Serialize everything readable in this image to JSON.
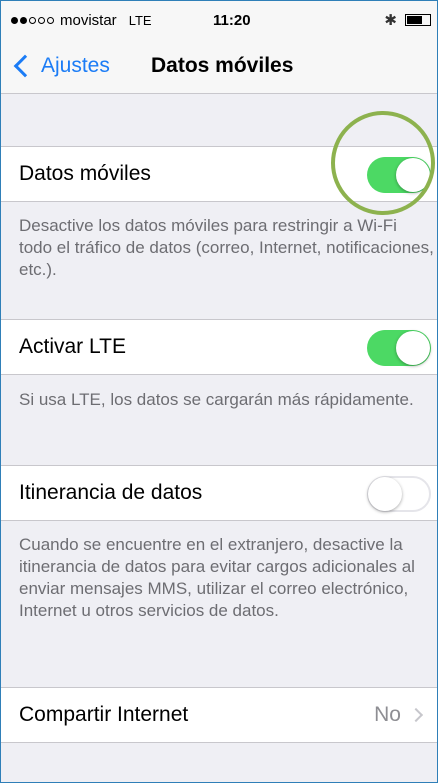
{
  "status_bar": {
    "signal_dots": [
      true,
      true,
      false,
      false,
      false
    ],
    "carrier": "movistar",
    "network": "LTE",
    "time": "11:20",
    "bluetooth_icon": "bluetooth-icon",
    "battery_level": 0.7
  },
  "nav": {
    "back_label": "Ajustes",
    "title": "Datos móviles"
  },
  "settings": {
    "datos_moviles": {
      "label": "Datos móviles",
      "on": true
    },
    "datos_moviles_footer": "Desactive los datos móviles para restringir a Wi-Fi todo el tráfico de datos (correo, Internet, notificaciones, etc.).",
    "activar_lte": {
      "label": "Activar LTE",
      "on": true
    },
    "activar_lte_footer": "Si usa LTE, los datos se cargarán más rápidamente.",
    "itinerancia": {
      "label": "Itinerancia de datos",
      "on": false
    },
    "itinerancia_footer": "Cuando se encuentre en el extranjero, desactive la itinerancia de datos para evitar cargos adicionales al enviar mensajes MMS, utilizar el correo electrónico, Internet u otros servicios de datos.",
    "compartir": {
      "label": "Compartir Internet",
      "value": "No"
    }
  },
  "colors": {
    "accent": "#1b7cf6",
    "switch_on": "#4cd964",
    "highlight_ring": "#8db24e"
  }
}
